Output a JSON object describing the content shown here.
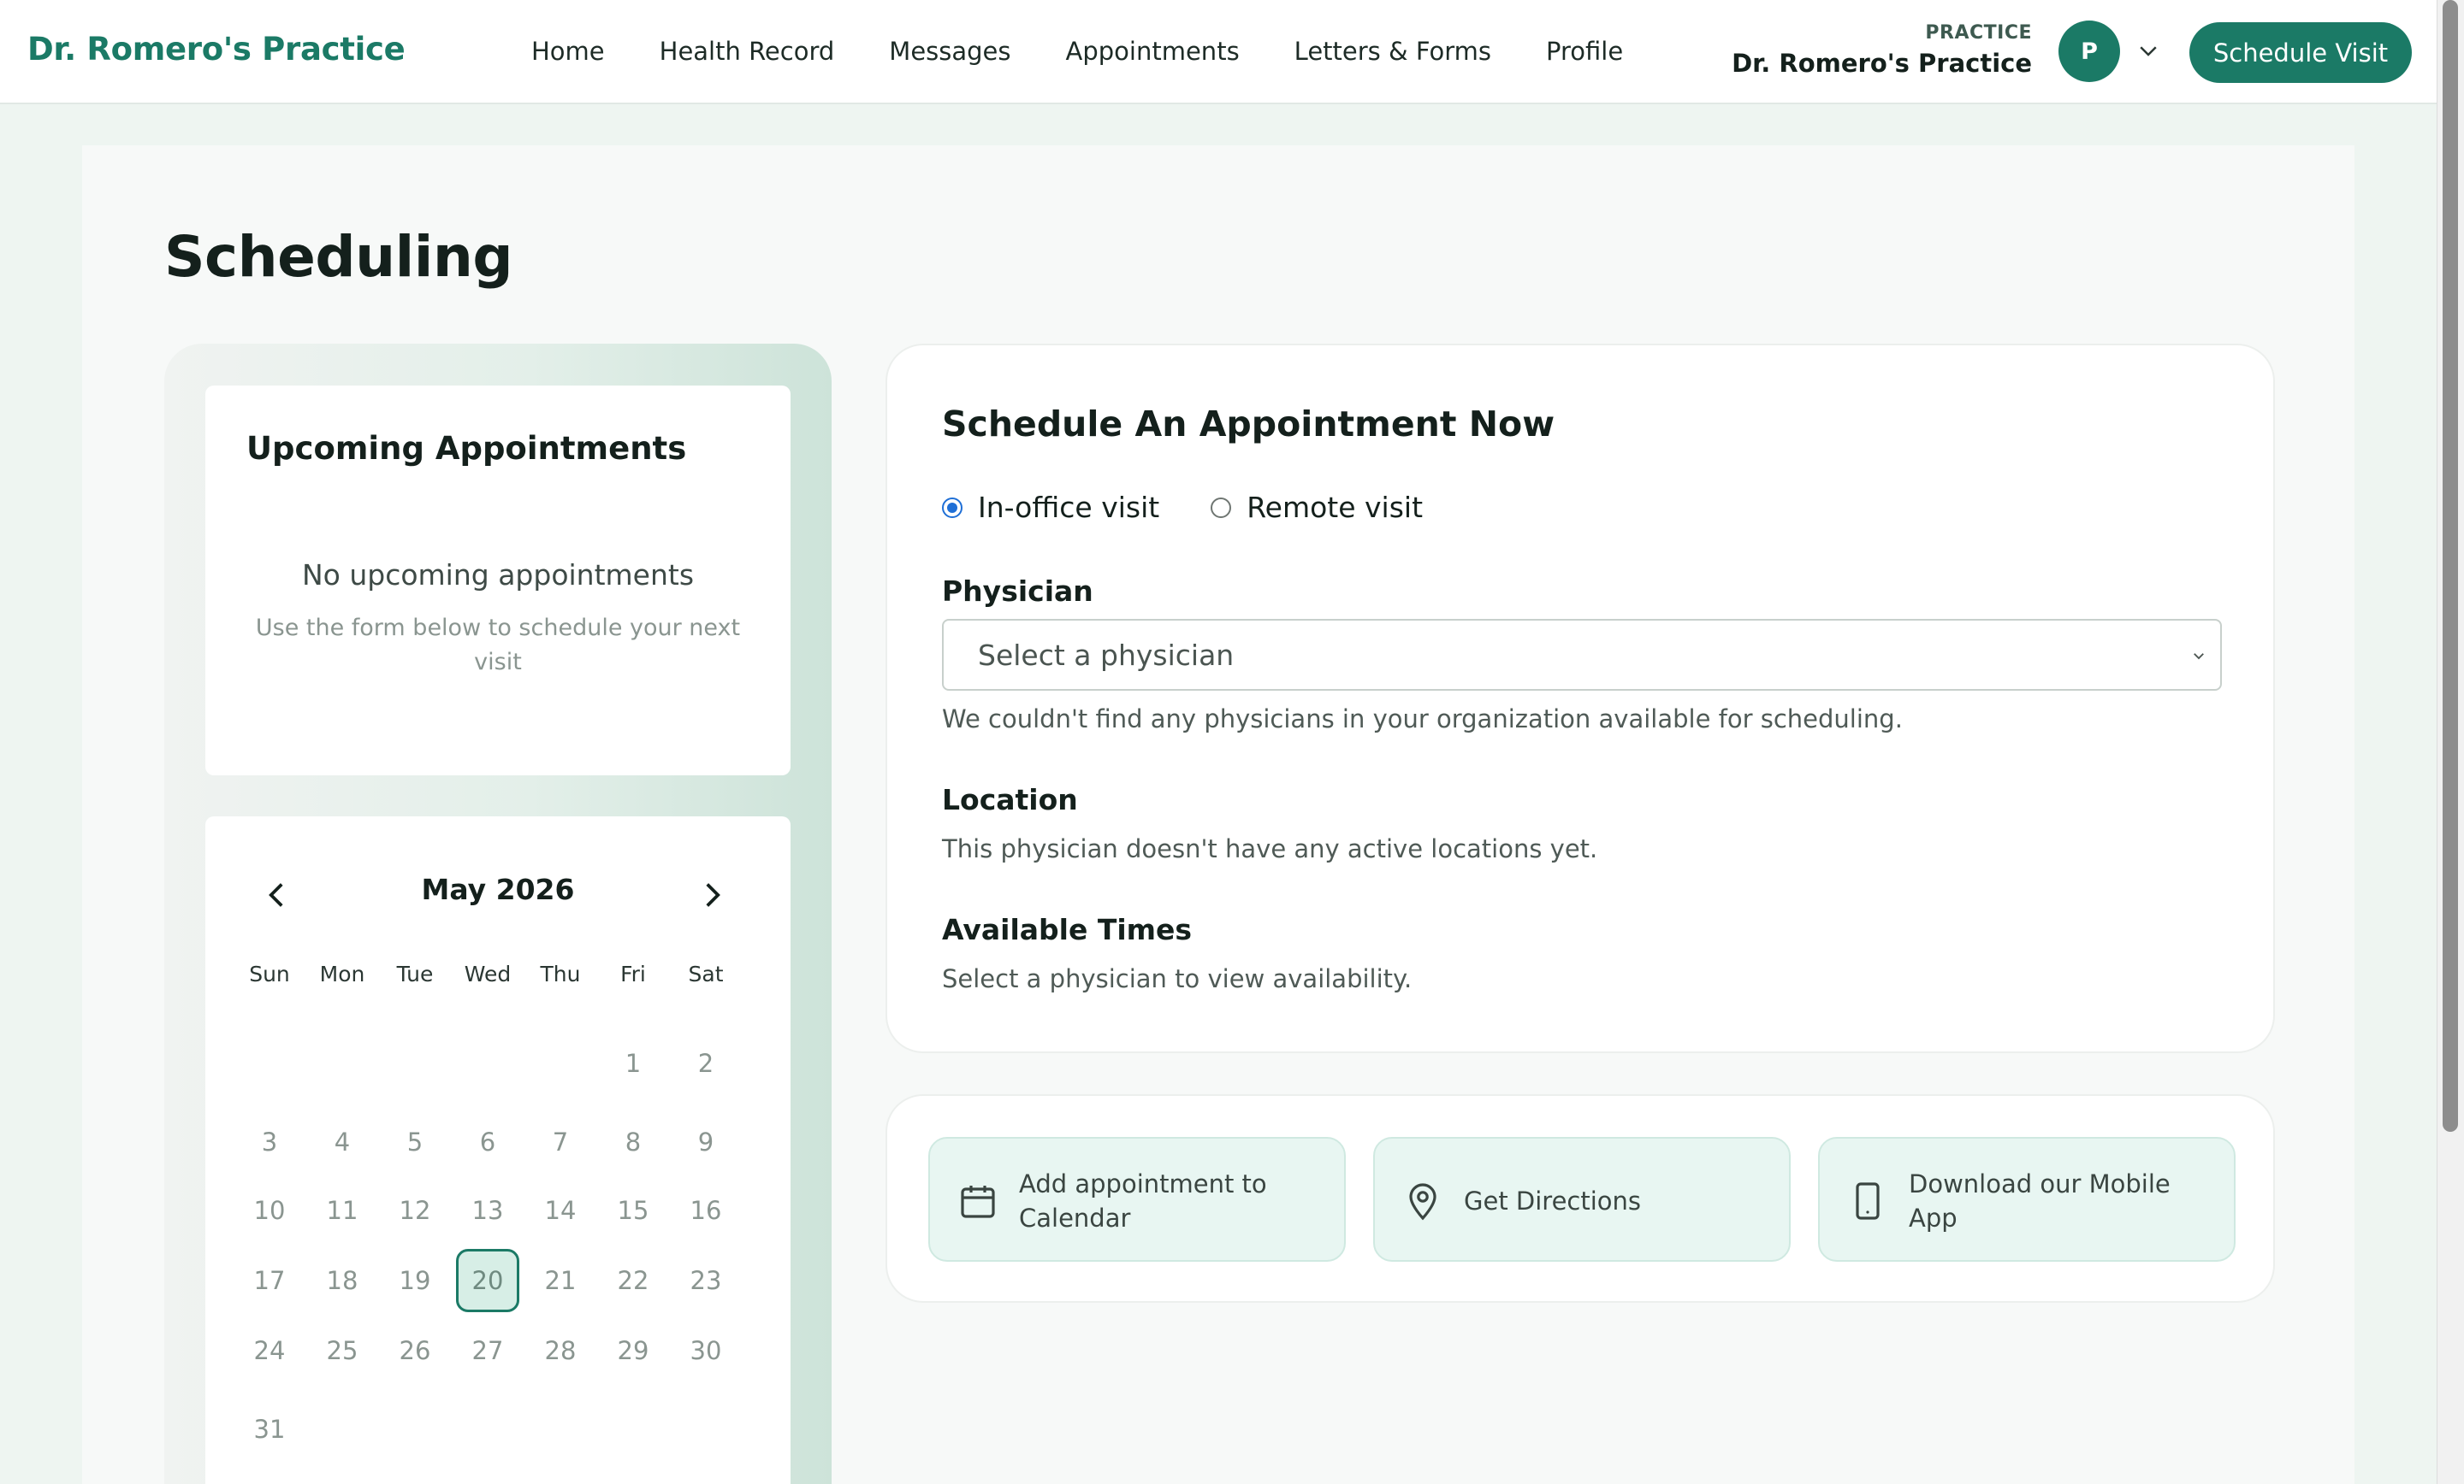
{
  "header": {
    "brand": "Dr. Romero's Practice",
    "nav": [
      "Home",
      "Health Record",
      "Messages",
      "Appointments",
      "Letters & Forms",
      "Profile"
    ],
    "practice_label": "PRACTICE",
    "practice_name": "Dr. Romero's Practice",
    "avatar_initial": "P",
    "schedule_button": "Schedule Visit"
  },
  "page": {
    "title": "Scheduling"
  },
  "upcoming": {
    "title": "Upcoming Appointments",
    "empty_text": "No upcoming appointments",
    "hint": "Use the form below to schedule your next visit"
  },
  "calendar": {
    "month_label": "May 2026",
    "weekdays": [
      "Sun",
      "Mon",
      "Tue",
      "Wed",
      "Thu",
      "Fri",
      "Sat"
    ],
    "first_weekday_index": 5,
    "days_in_month": 31,
    "selected_day": 20
  },
  "form": {
    "title": "Schedule An Appointment Now",
    "visit_types": [
      {
        "label": "In-office visit",
        "checked": true
      },
      {
        "label": "Remote visit",
        "checked": false
      }
    ],
    "physician_label": "Physician",
    "physician_placeholder": "Select a physician",
    "physician_help": "We couldn't find any physicians in your organization available for scheduling.",
    "location_label": "Location",
    "location_help": "This physician doesn't have any active locations yet.",
    "times_label": "Available Times",
    "times_help": "Select a physician to view availability."
  },
  "actions": [
    {
      "label": "Add appointment to Calendar",
      "icon": "calendar-icon"
    },
    {
      "label": "Get Directions",
      "icon": "map-pin-icon"
    },
    {
      "label": "Download our Mobile App",
      "icon": "mobile-phone-icon"
    }
  ],
  "colors": {
    "brand": "#1b7a66",
    "accent_light": "#e8f6f2",
    "radio": "#1f6fd6"
  }
}
